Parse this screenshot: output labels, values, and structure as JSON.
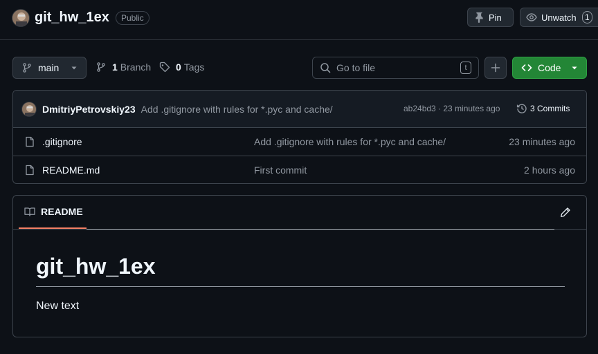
{
  "repo": {
    "name": "git_hw_1ex",
    "visibility": "Public",
    "pin_label": "Pin",
    "watch_label": "Unwatch",
    "watch_count": "1"
  },
  "toolbar": {
    "branch": "main",
    "branch_count": "1",
    "branch_label": "Branch",
    "tag_count": "0",
    "tag_label": "Tags",
    "search_placeholder": "Go to file",
    "search_shortcut": "t",
    "code_label": "Code"
  },
  "latest_commit": {
    "author": "DmitriyPetrovskiy23",
    "message": "Add .gitignore with rules for *.pyc and cache/",
    "meta": "ab24bd3 · 23 minutes ago",
    "commits_label": "3 Commits"
  },
  "files": [
    {
      "name": ".gitignore",
      "message": "Add .gitignore with rules for *.pyc and cache/",
      "time": "23 minutes ago"
    },
    {
      "name": "README.md",
      "message": "First commit",
      "time": "2 hours ago"
    }
  ],
  "readme": {
    "tab_label": "README",
    "heading": "git_hw_1ex",
    "body": "New text"
  },
  "colors": {
    "background": "#0d1117",
    "border": "#3d444d",
    "primary_button": "#238636",
    "tab_underline": "#f78166"
  },
  "icons": [
    "pin-icon",
    "eye-icon",
    "branch-icon",
    "tag-icon",
    "search-icon",
    "plus-icon",
    "code-icon",
    "caret-down-icon",
    "history-icon",
    "file-icon",
    "book-icon",
    "pencil-icon"
  ]
}
